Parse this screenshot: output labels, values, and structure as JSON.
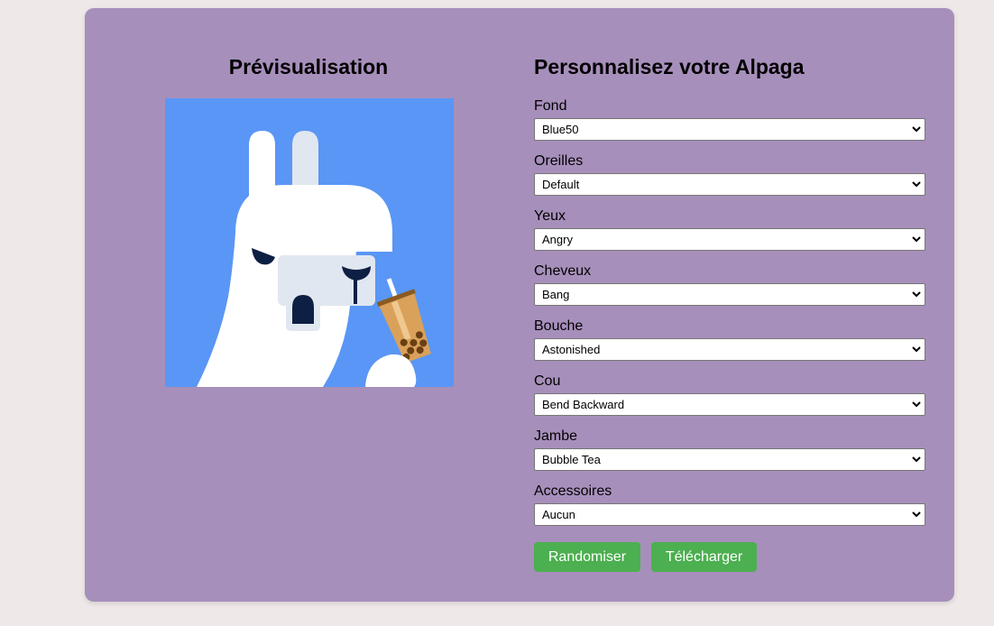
{
  "preview": {
    "title": "Prévisualisation",
    "image_alt": "alpaca-preview"
  },
  "customize": {
    "title": "Personnalisez votre Alpaga",
    "fields": [
      {
        "label": "Fond",
        "value": "Blue50"
      },
      {
        "label": "Oreilles",
        "value": "Default"
      },
      {
        "label": "Yeux",
        "value": "Angry"
      },
      {
        "label": "Cheveux",
        "value": "Bang"
      },
      {
        "label": "Bouche",
        "value": "Astonished"
      },
      {
        "label": "Cou",
        "value": "Bend Backward"
      },
      {
        "label": "Jambe",
        "value": "Bubble Tea"
      },
      {
        "label": "Accessoires",
        "value": "Aucun"
      }
    ]
  },
  "buttons": {
    "randomize": "Randomiser",
    "download": "Télécharger"
  },
  "colors": {
    "page_bg": "#efe8e8",
    "card_bg": "#a78fbb",
    "button_bg": "#4caf50",
    "alpaca_bg": "#5a96f5"
  }
}
